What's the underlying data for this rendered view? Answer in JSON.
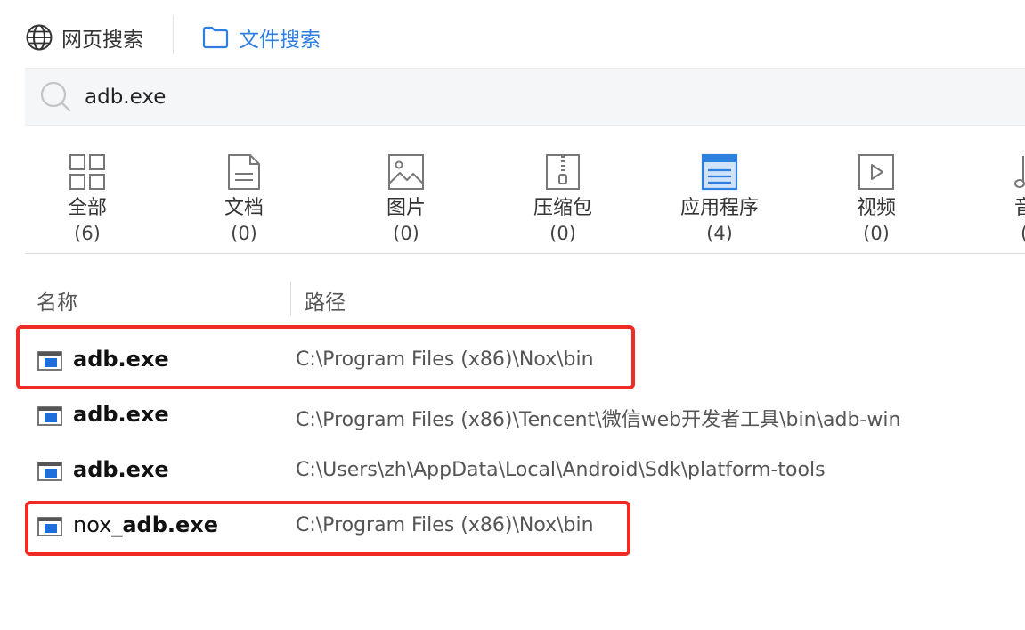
{
  "tabs": {
    "web_search": "网页搜索",
    "file_search": "文件搜索"
  },
  "search": {
    "value": "adb.exe"
  },
  "categories": [
    {
      "name": "全部",
      "count": "(6)"
    },
    {
      "name": "文档",
      "count": "(0)"
    },
    {
      "name": "图片",
      "count": "(0)"
    },
    {
      "name": "压缩包",
      "count": "(0)"
    },
    {
      "name": "应用程序",
      "count": "(4)"
    },
    {
      "name": "视频",
      "count": "(0)"
    },
    {
      "name": "音",
      "count": "("
    }
  ],
  "table": {
    "col_name": "名称",
    "col_path": "路径",
    "rows": [
      {
        "name": "adb.exe",
        "path": "C:\\Program Files (x86)\\Nox\\bin"
      },
      {
        "name": "adb.exe",
        "path": "C:\\Program Files (x86)\\Tencent\\微信web开发者工具\\bin\\adb-win"
      },
      {
        "name": "adb.exe",
        "path": "C:\\Users\\zh\\AppData\\Local\\Android\\Sdk\\platform-tools"
      },
      {
        "name_prefix": "nox_",
        "name_rest": "adb.exe",
        "path": "C:\\Program Files (x86)\\Nox\\bin"
      }
    ]
  },
  "colors": {
    "accent": "#2f7fe0",
    "highlight": "#ee2b24"
  }
}
